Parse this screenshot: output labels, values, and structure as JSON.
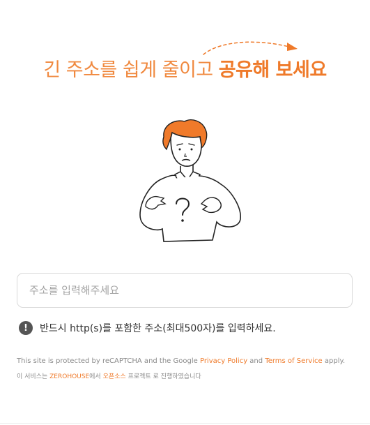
{
  "headline": {
    "normal": "긴 주소를 쉽게 줄이고 ",
    "emphasis": "공유해 보세요"
  },
  "illustration": {
    "name": "confused-person-illustration"
  },
  "input": {
    "placeholder": "주소를 입력해주세요",
    "value": ""
  },
  "notice": {
    "icon": "exclamation-icon",
    "text": "반드시 http(s)를 포함한 주소(최대500자)를 입력하세요."
  },
  "footer": {
    "line1_prefix": "This site is protected by reCAPTCHA and the Google ",
    "privacy_link": "Privacy Policy",
    "line1_and": " and ",
    "terms_link": "Terms of Service",
    "line1_suffix": " apply.",
    "line2_prefix": "이 서비스는 ",
    "zerohouse_link": "ZEROHOUSE",
    "line2_mid": "에서 ",
    "opensource_link": "오픈소스",
    "line2_suffix": " 프로젝트 로 진행하였습니다"
  },
  "colors": {
    "accent": "#ef7a2a",
    "text": "#333333",
    "muted": "#8a8a8a",
    "hair": "#f07a2a"
  }
}
